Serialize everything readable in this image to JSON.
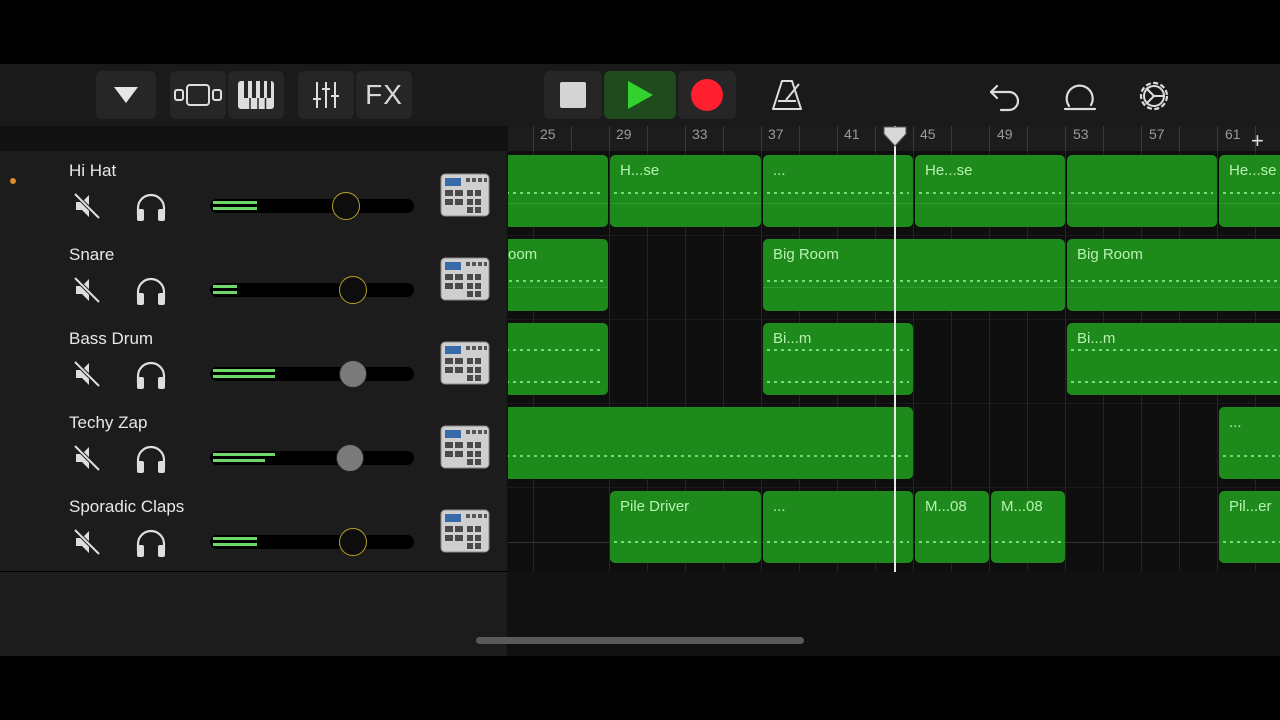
{
  "toolbar": {
    "fx_label": "FX"
  },
  "ruler": {
    "bars": [
      "25",
      "29",
      "33",
      "37",
      "41",
      "45",
      "49",
      "53",
      "57",
      "61"
    ],
    "add_label": "+"
  },
  "tracks": [
    {
      "name": "Hi Hat",
      "active": true,
      "volume_knob": "yellow"
    },
    {
      "name": "Snare",
      "active": false,
      "volume_knob": "yellow"
    },
    {
      "name": "Bass Drum",
      "active": false,
      "volume_knob": "grey"
    },
    {
      "name": "Techy Zap",
      "active": false,
      "volume_knob": "grey"
    },
    {
      "name": "Sporadic Claps",
      "active": false,
      "volume_knob": "yellow"
    }
  ],
  "regions": {
    "hihat": [
      "H...se",
      "...",
      "He...se",
      "He...se"
    ],
    "snare": [
      "oom",
      "Big Room",
      "Big Room"
    ],
    "bass": [
      "Bi...m",
      "Bi...m"
    ],
    "zap": [
      "..."
    ],
    "claps": [
      "Pile Driver",
      "...",
      "M...08",
      "M...08",
      "Pil...er"
    ]
  },
  "add_track_label": "+",
  "colors": {
    "region": "#1f8a1c",
    "meter": "#6cd86a",
    "record": "#ff1f2e",
    "play": "#33d12e"
  }
}
